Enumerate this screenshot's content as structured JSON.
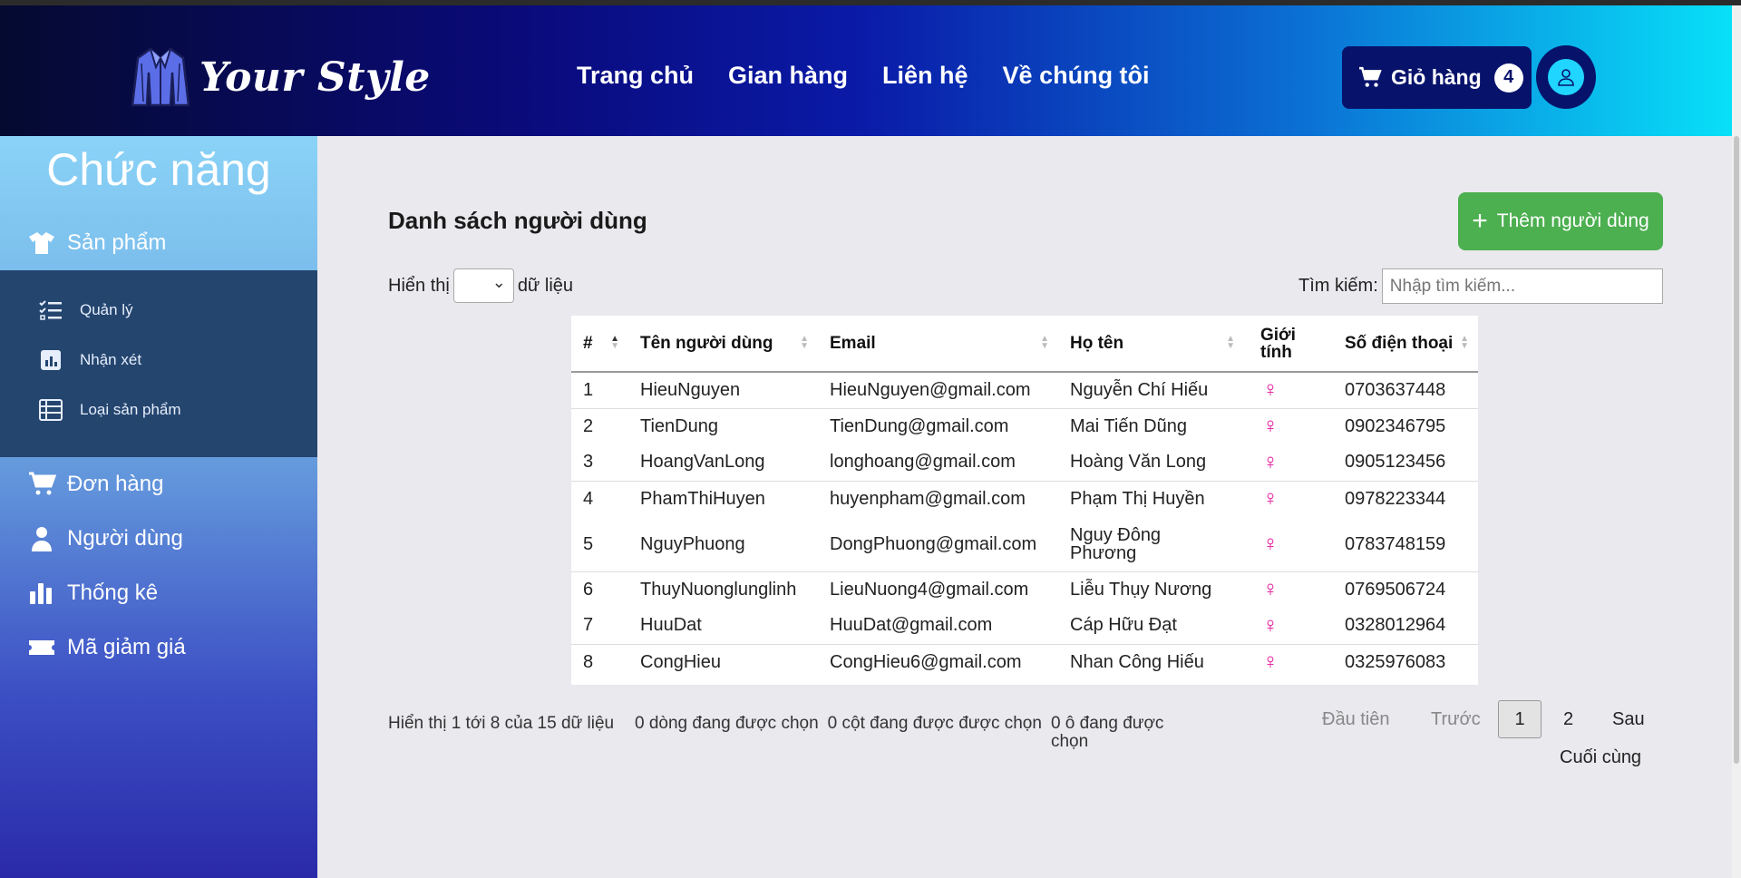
{
  "header": {
    "logo_text": "Your Style",
    "nav": [
      "Trang chủ",
      "Gian hàng",
      "Liên hệ",
      "Về chúng tôi"
    ],
    "cart_label": "Giỏ hàng",
    "cart_count": "4"
  },
  "sidebar": {
    "title": "Chức năng",
    "products": "Sản phẩm",
    "sub": [
      "Quản lý",
      "Nhận xét",
      "Loại sản phẩm"
    ],
    "orders": "Đơn hàng",
    "users": "Người dùng",
    "stats": "Thống kê",
    "coupons": "Mã giảm giá"
  },
  "main": {
    "title": "Danh sách người dùng",
    "add_button": "Thêm người dùng",
    "show_prefix": "Hiển thị",
    "show_suffix": "dữ liệu",
    "search_label": "Tìm kiếm:",
    "search_placeholder": "Nhập tìm kiếm..."
  },
  "table": {
    "headers": [
      "#",
      "Tên người dùng",
      "Email",
      "Họ tên",
      "Giới tính",
      "Số điện thoại"
    ],
    "rows": [
      [
        "1",
        "HieuNguyen",
        "HieuNguyen@gmail.com",
        "Nguyễn Chí Hiếu",
        "♀",
        "0703637448"
      ],
      [
        "2",
        "TienDung",
        "TienDung@gmail.com",
        "Mai Tiến Dũng",
        "♀",
        "0902346795"
      ],
      [
        "3",
        "HoangVanLong",
        "longhoang@gmail.com",
        "Hoàng Văn Long",
        "♀",
        "0905123456"
      ],
      [
        "4",
        "PhamThiHuyen",
        "huyenpham@gmail.com",
        "Phạm Thị Huyền",
        "♀",
        "0978223344"
      ],
      [
        "5",
        "NguyPhuong",
        "DongPhuong@gmail.com",
        "Nguy Đông Phương",
        "♀",
        "0783748159"
      ],
      [
        "6",
        "ThuyNuonglunglinh",
        "LieuNuong4@gmail.com",
        "Liễu Thụy Nương",
        "♀",
        "0769506724"
      ],
      [
        "7",
        "HuuDat",
        "HuuDat@gmail.com",
        "Cáp Hữu Đạt",
        "♀",
        "0328012964"
      ],
      [
        "8",
        "CongHieu",
        "CongHieu6@gmail.com",
        "Nhan Công Hiếu",
        "♀",
        "0325976083"
      ]
    ]
  },
  "footer": {
    "info": "Hiển thị 1 tới 8 của 15 dữ liệu",
    "rows_selected": "0 dòng đang được chọn",
    "cols_selected": "0 cột đang được được chọn",
    "cells_selected": "0 ô đang được chọn",
    "first": "Đầu tiên",
    "prev": "Trước",
    "page1": "1",
    "page2": "2",
    "next": "Sau",
    "last": "Cuối cùng"
  },
  "colors": {
    "add_button": "#4caf50",
    "female_icon": "#e6189a",
    "header_dark": "#07136b"
  }
}
